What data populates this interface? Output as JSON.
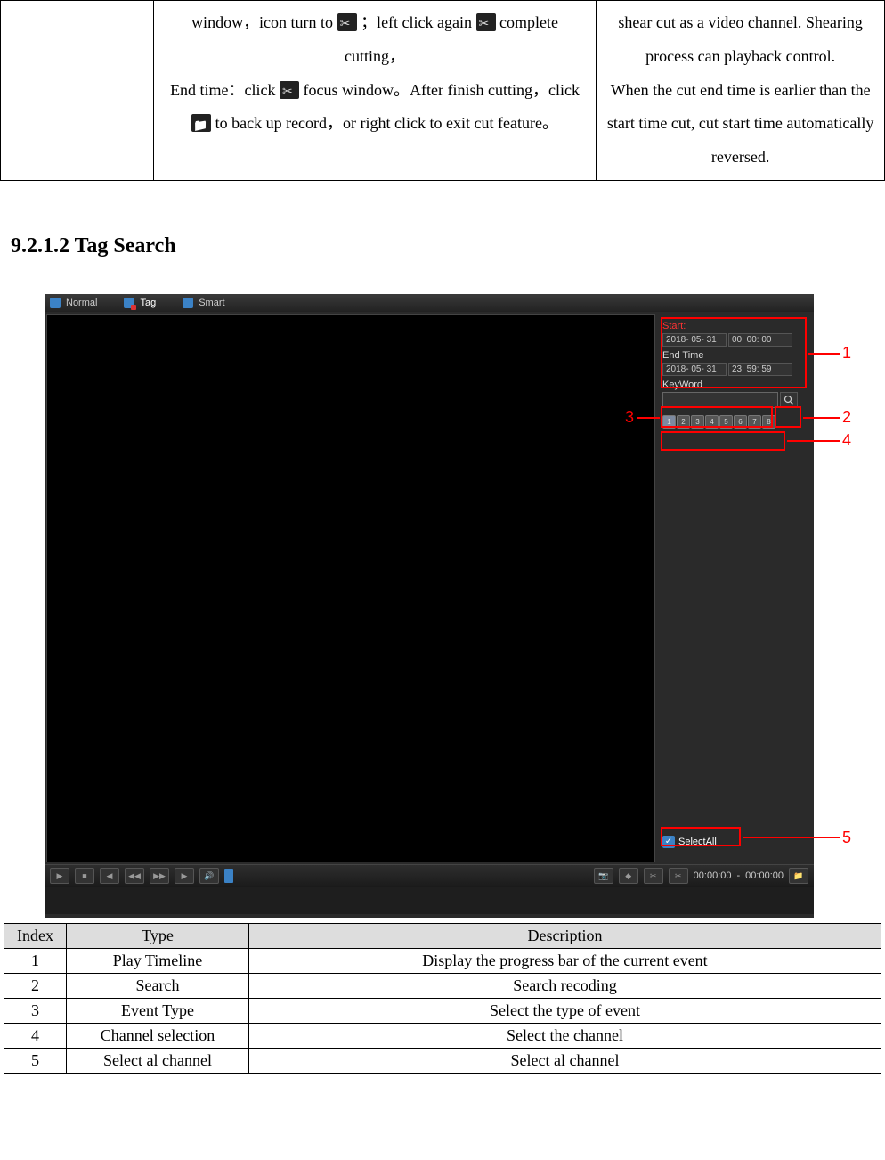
{
  "top_table": {
    "cell2_a": "window，icon turn to ",
    "cell2_b": "；left click again",
    "cell2_c": "complete cutting，",
    "cell2_d": "End time：click",
    "cell2_e": "focus window。After finish cutting，click",
    "cell2_f": "to back up record，or right click to exit cut feature。",
    "cell3": "shear cut as a video channel. Shearing process can playback control.\nWhen the cut end time is earlier than the start time cut, cut start time automatically reversed."
  },
  "heading": "9.2.1.2 Tag Search",
  "tabs": {
    "normal": "Normal",
    "tag": "Tag",
    "smart": "Smart"
  },
  "panel": {
    "start_label": "Start:",
    "start_date": "2018- 05- 31",
    "start_time": "00: 00: 00",
    "end_label": "End Time",
    "end_date": "2018- 05- 31",
    "end_time": "23: 59: 59",
    "keyword_label": "KeyWord",
    "channels": [
      "1",
      "2",
      "3",
      "4",
      "5",
      "6",
      "7",
      "8"
    ],
    "selectall": "SelectAll"
  },
  "toolbar": {
    "time_left": "00:00:00",
    "time_sep": " - ",
    "time_right": "00:00:00"
  },
  "callouts": {
    "n1": "1",
    "n2": "2",
    "n3": "3",
    "n4": "4",
    "n5": "5"
  },
  "desc_table": {
    "headers": {
      "index": "Index",
      "type": "Type",
      "desc": "Description"
    },
    "rows": [
      {
        "index": "1",
        "type": "Play Timeline",
        "desc": "Display the progress bar of the current event"
      },
      {
        "index": "2",
        "type": "Search",
        "desc": "Search recoding"
      },
      {
        "index": "3",
        "type": "Event Type",
        "desc": "Select the type of event"
      },
      {
        "index": "4",
        "type": "Channel selection",
        "desc": "Select the channel"
      },
      {
        "index": "5",
        "type": "Select al channel",
        "desc": "Select al channel"
      }
    ]
  }
}
